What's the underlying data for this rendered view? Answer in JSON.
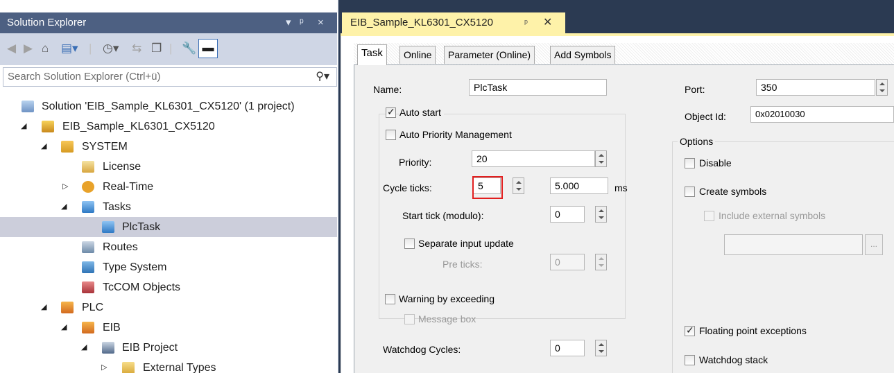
{
  "solution_explorer": {
    "title": "Solution Explorer",
    "title_controls": [
      "▾",
      "ᵖ",
      "×"
    ],
    "search_placeholder": "Search Solution Explorer (Ctrl+ü)",
    "tree": [
      {
        "label": "Solution 'EIB_Sample_KL6301_CX5120' (1 project)",
        "icon": "solution-icon"
      },
      {
        "label": "EIB_Sample_KL6301_CX5120",
        "icon": "project-icon",
        "expanded": true
      },
      {
        "label": "SYSTEM",
        "icon": "system-icon",
        "expanded": true
      },
      {
        "label": "License",
        "icon": "license-icon"
      },
      {
        "label": "Real-Time",
        "icon": "realtime-icon",
        "expanded": false
      },
      {
        "label": "Tasks",
        "icon": "tasks-icon",
        "expanded": true
      },
      {
        "label": "PlcTask",
        "icon": "task-icon",
        "selected": true
      },
      {
        "label": "Routes",
        "icon": "routes-icon"
      },
      {
        "label": "Type System",
        "icon": "type-system-icon"
      },
      {
        "label": "TcCOM Objects",
        "icon": "tccom-icon"
      },
      {
        "label": "PLC",
        "icon": "plc-icon",
        "expanded": true
      },
      {
        "label": "EIB",
        "icon": "plc-project-icon",
        "expanded": true
      },
      {
        "label": "EIB Project",
        "icon": "eib-project-icon",
        "expanded": true
      },
      {
        "label": "External Types",
        "icon": "folder-icon",
        "expanded": false
      }
    ]
  },
  "document": {
    "tab_title": "EIB_Sample_KL6301_CX5120",
    "tabs": [
      "Task",
      "Online",
      "Parameter (Online)",
      "Add Symbols"
    ],
    "task": {
      "name_label": "Name:",
      "name_value": "PlcTask",
      "auto_start_label": "Auto start",
      "auto_start_checked": true,
      "auto_priority_label": "Auto Priority Management",
      "auto_priority_checked": false,
      "priority_label": "Priority:",
      "priority_value": "20",
      "cycle_ticks_label": "Cycle ticks:",
      "cycle_ticks_value": "5",
      "cycle_time_value": "5.000",
      "cycle_time_unit": "ms",
      "start_tick_label": "Start tick (modulo):",
      "start_tick_value": "0",
      "separate_input_label": "Separate input update",
      "separate_input_checked": false,
      "pre_ticks_label": "Pre ticks:",
      "pre_ticks_value": "0",
      "warning_label": "Warning by exceeding",
      "warning_checked": false,
      "message_box_label": "Message box",
      "watchdog_label": "Watchdog Cycles:",
      "watchdog_value": "0",
      "port_label": "Port:",
      "port_value": "350",
      "object_id_label": "Object Id:",
      "object_id_value": "0x02010030",
      "options_label": "Options",
      "disable_label": "Disable",
      "create_symbols_label": "Create symbols",
      "include_external_label": "Include external symbols",
      "floating_point_label": "Floating point exceptions",
      "floating_point_checked": true,
      "watchdog_stack_label": "Watchdog stack"
    }
  }
}
